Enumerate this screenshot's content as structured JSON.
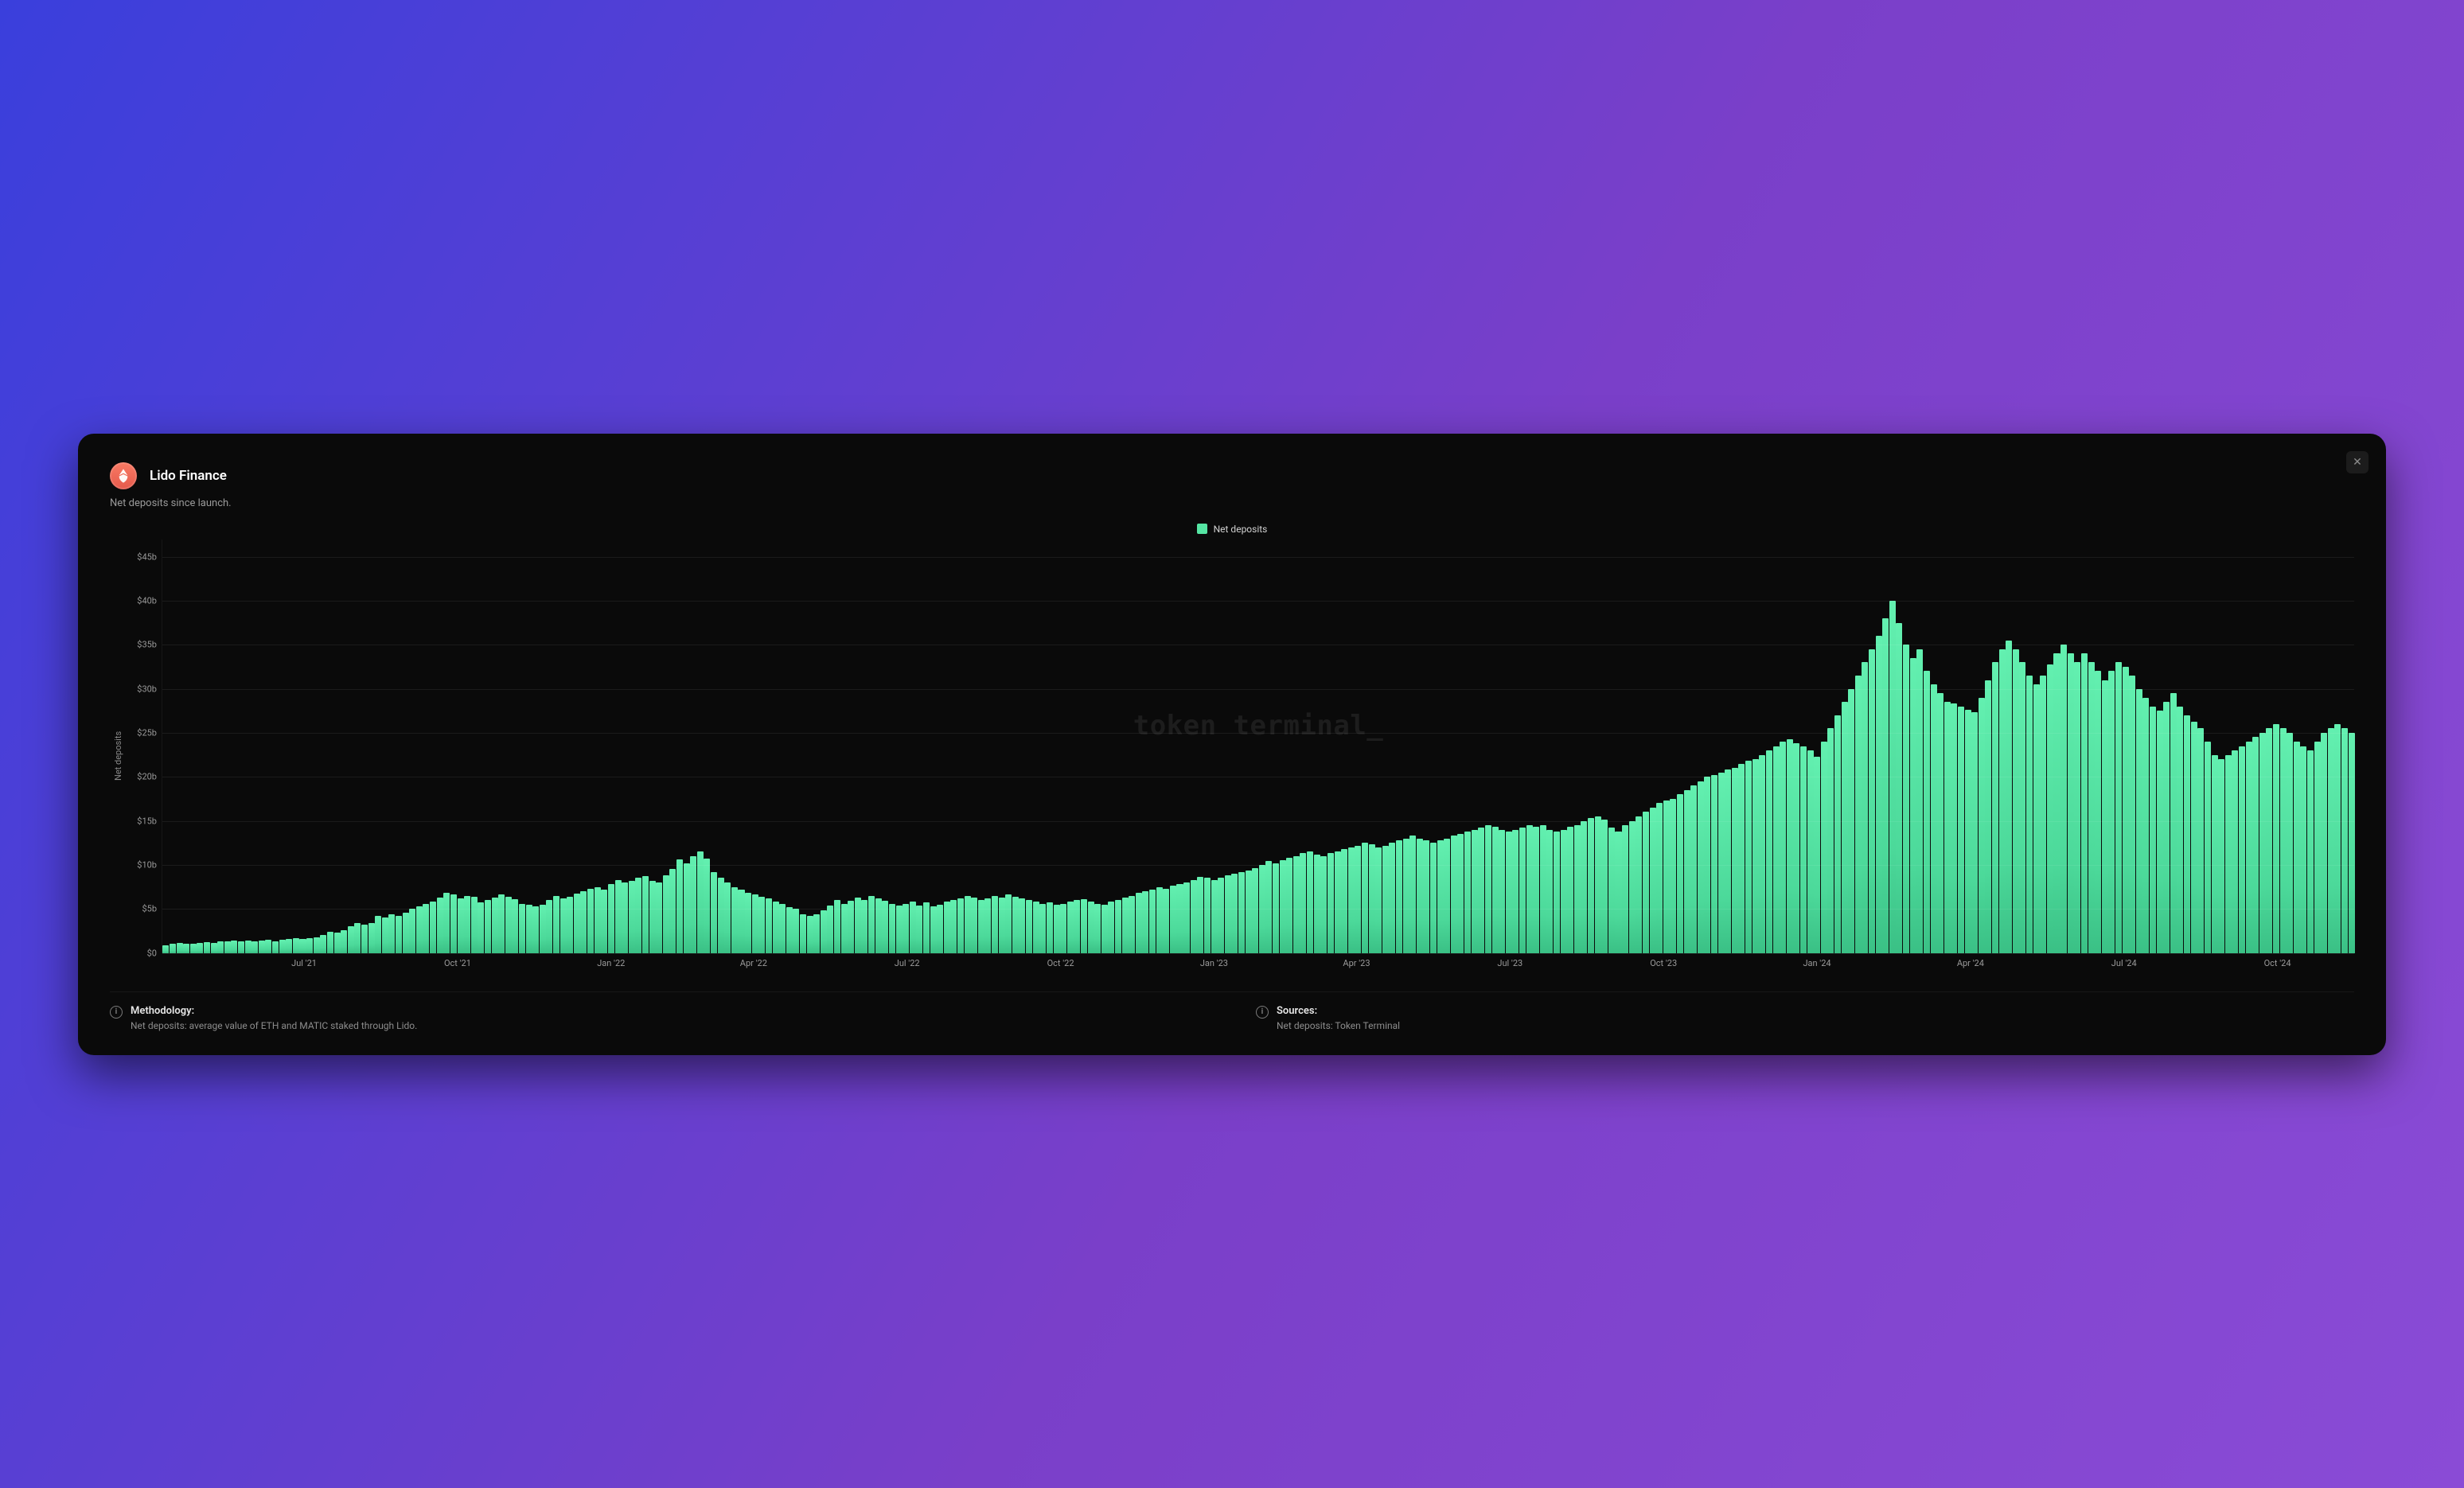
{
  "header": {
    "title": "Lido Finance",
    "subtitle": "Net deposits since launch."
  },
  "close_glyph": "✕",
  "legend": {
    "series_label": "Net deposits"
  },
  "watermark": "token terminal_",
  "footer": {
    "methodology_title": "Methodology:",
    "methodology_body": "Net deposits: average value of ETH and MATIC staked through Lido.",
    "sources_title": "Sources:",
    "sources_body": "Net deposits: Token Terminal"
  },
  "chart_data": {
    "type": "area",
    "title": "Lido Finance — Net deposits since launch",
    "xlabel": "",
    "ylabel": "Net deposits",
    "ylim": [
      0,
      47
    ],
    "y_ticks": [
      {
        "v": 0,
        "label": "$0"
      },
      {
        "v": 5,
        "label": "$5b"
      },
      {
        "v": 10,
        "label": "$10b"
      },
      {
        "v": 15,
        "label": "$15b"
      },
      {
        "v": 20,
        "label": "$20b"
      },
      {
        "v": 25,
        "label": "$25b"
      },
      {
        "v": 30,
        "label": "$30b"
      },
      {
        "v": 35,
        "label": "$35b"
      },
      {
        "v": 40,
        "label": "$40b"
      },
      {
        "v": 45,
        "label": "$45b"
      }
    ],
    "x_ticks": [
      {
        "pos": 0.065,
        "label": "Jul '21"
      },
      {
        "pos": 0.135,
        "label": "Oct '21"
      },
      {
        "pos": 0.205,
        "label": "Jan '22"
      },
      {
        "pos": 0.27,
        "label": "Apr '22"
      },
      {
        "pos": 0.34,
        "label": "Jul '22"
      },
      {
        "pos": 0.41,
        "label": "Oct '22"
      },
      {
        "pos": 0.48,
        "label": "Jan '23"
      },
      {
        "pos": 0.545,
        "label": "Apr '23"
      },
      {
        "pos": 0.615,
        "label": "Jul '23"
      },
      {
        "pos": 0.685,
        "label": "Oct '23"
      },
      {
        "pos": 0.755,
        "label": "Jan '24"
      },
      {
        "pos": 0.825,
        "label": "Apr '24"
      },
      {
        "pos": 0.895,
        "label": "Jul '24"
      },
      {
        "pos": 0.965,
        "label": "Oct '24"
      }
    ],
    "series": [
      {
        "name": "Net deposits",
        "color": "#55e5a3",
        "unit": "USD (billions)",
        "values": [
          0.9,
          1.0,
          1.1,
          1.0,
          1.0,
          1.1,
          1.2,
          1.1,
          1.3,
          1.3,
          1.4,
          1.3,
          1.4,
          1.3,
          1.4,
          1.5,
          1.3,
          1.5,
          1.6,
          1.7,
          1.6,
          1.7,
          1.8,
          2.0,
          2.4,
          2.3,
          2.6,
          3.0,
          3.4,
          3.2,
          3.4,
          4.2,
          4.0,
          4.4,
          4.2,
          4.6,
          5.0,
          5.3,
          5.6,
          5.8,
          6.3,
          6.8,
          6.6,
          6.2,
          6.5,
          6.4,
          5.7,
          6.0,
          6.3,
          6.6,
          6.4,
          6.1,
          5.6,
          5.5,
          5.3,
          5.5,
          6.0,
          6.5,
          6.2,
          6.4,
          6.7,
          7.0,
          7.3,
          7.5,
          7.2,
          7.8,
          8.3,
          8.0,
          8.2,
          8.5,
          8.7,
          8.2,
          8.0,
          8.8,
          9.5,
          10.6,
          10.2,
          11.0,
          11.5,
          10.7,
          9.2,
          8.5,
          8.0,
          7.5,
          7.2,
          6.8,
          6.6,
          6.4,
          6.2,
          5.8,
          5.6,
          5.2,
          5.0,
          4.4,
          4.2,
          4.4,
          4.8,
          5.4,
          6.0,
          5.6,
          5.9,
          6.3,
          6.0,
          6.5,
          6.2,
          5.9,
          5.6,
          5.4,
          5.6,
          5.8,
          5.4,
          5.7,
          5.3,
          5.5,
          5.8,
          6.0,
          6.2,
          6.5,
          6.3,
          6.0,
          6.2,
          6.5,
          6.3,
          6.6,
          6.4,
          6.2,
          6.0,
          5.8,
          5.6,
          5.7,
          5.5,
          5.6,
          5.8,
          6.0,
          6.1,
          5.8,
          5.6,
          5.5,
          5.8,
          6.0,
          6.3,
          6.5,
          6.8,
          7.0,
          7.2,
          7.5,
          7.3,
          7.6,
          7.8,
          8.0,
          8.3,
          8.6,
          8.5,
          8.3,
          8.5,
          8.8,
          9.0,
          9.2,
          9.4,
          9.6,
          10.0,
          10.4,
          10.2,
          10.5,
          10.8,
          11.0,
          11.3,
          11.5,
          11.2,
          11.0,
          11.3,
          11.5,
          11.8,
          12.0,
          12.2,
          12.5,
          12.3,
          12.0,
          12.2,
          12.5,
          12.8,
          13.0,
          13.3,
          13.0,
          12.8,
          12.5,
          12.8,
          13.0,
          13.3,
          13.5,
          13.8,
          14.0,
          14.2,
          14.5,
          14.3,
          14.0,
          13.8,
          14.0,
          14.2,
          14.5,
          14.3,
          14.5,
          14.0,
          13.8,
          14.0,
          14.3,
          14.5,
          15.0,
          15.3,
          15.5,
          15.1,
          14.2,
          13.8,
          14.5,
          15.0,
          15.5,
          16.0,
          16.5,
          17.0,
          17.3,
          17.5,
          18.0,
          18.5,
          19.0,
          19.5,
          20.0,
          20.2,
          20.5,
          20.8,
          21.0,
          21.5,
          21.8,
          22.0,
          22.5,
          23.0,
          23.5,
          24.0,
          24.3,
          23.8,
          23.5,
          23.0,
          22.3,
          24.0,
          25.5,
          27.0,
          28.5,
          30.0,
          31.5,
          33.0,
          34.5,
          36.0,
          38.0,
          40.0,
          37.5,
          35.0,
          33.5,
          34.5,
          32.0,
          30.5,
          29.5,
          28.5,
          28.3,
          28.0,
          27.6,
          27.3,
          29.0,
          31.0,
          33.0,
          34.5,
          35.5,
          34.5,
          33.0,
          31.5,
          30.5,
          31.5,
          32.8,
          34.0,
          35.0,
          34.0,
          33.0,
          34.0,
          33.0,
          32.0,
          31.0,
          32.0,
          33.0,
          32.5,
          31.5,
          30.0,
          29.0,
          28.0,
          27.5,
          28.5,
          29.5,
          28.0,
          27.0,
          26.3,
          25.5,
          24.0,
          22.5,
          22.0,
          22.5,
          23.0,
          23.5,
          24.0,
          24.5,
          25.0,
          25.5,
          26.0,
          25.5,
          25.0,
          24.0,
          23.5,
          23.0,
          24.0,
          25.0,
          25.5,
          26.0,
          25.5,
          25.0
        ]
      }
    ]
  }
}
